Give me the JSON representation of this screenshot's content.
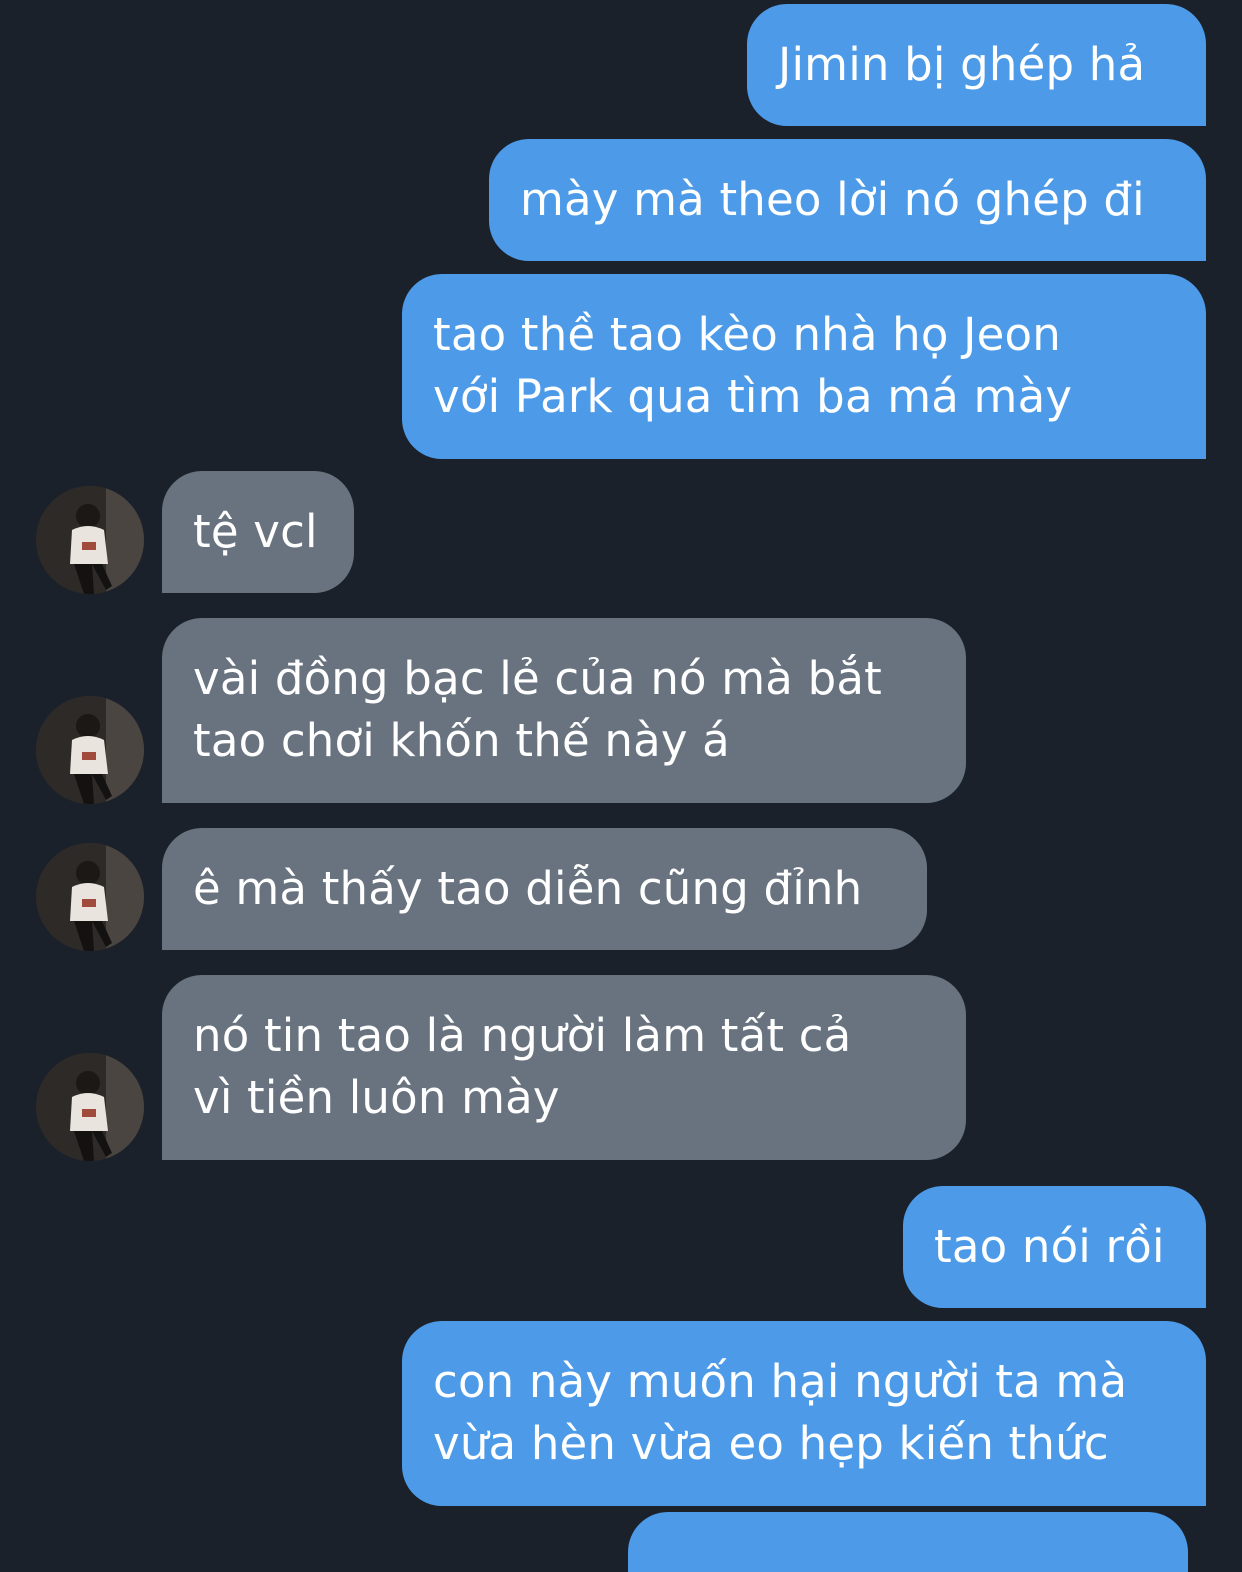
{
  "conversation": {
    "messages": [
      {
        "direction": "outgoing",
        "lines": [
          "Jimin bị ghép hả"
        ]
      },
      {
        "direction": "outgoing",
        "lines": [
          "mày mà theo lời nó ghép đi"
        ]
      },
      {
        "direction": "outgoing",
        "lines": [
          "tao thề tao kèo nhà họ Jeon",
          "với Park qua tìm ba má mày"
        ]
      },
      {
        "direction": "incoming",
        "lines": [
          "tệ vcl"
        ]
      },
      {
        "direction": "incoming",
        "lines": [
          "vài đồng bạc lẻ của nó mà bắt",
          "tao chơi khốn thế này á"
        ]
      },
      {
        "direction": "incoming",
        "lines": [
          "ê mà thấy tao diễn cũng đỉnh"
        ]
      },
      {
        "direction": "incoming",
        "lines": [
          "nó tin tao là người làm tất cả",
          "vì tiền luôn mày"
        ]
      },
      {
        "direction": "outgoing",
        "lines": [
          "tao nói rồi"
        ]
      },
      {
        "direction": "outgoing",
        "lines": [
          "con này muốn hại người ta mà",
          "vừa hèn vừa eo hẹp kiến thức"
        ]
      }
    ]
  },
  "colors": {
    "background": "#1a212b",
    "outgoing_bubble": "#4d9be8",
    "incoming_bubble": "#68737f",
    "text": "#ffffff"
  },
  "icons": {
    "avatar": "contact-photo-avatar"
  }
}
